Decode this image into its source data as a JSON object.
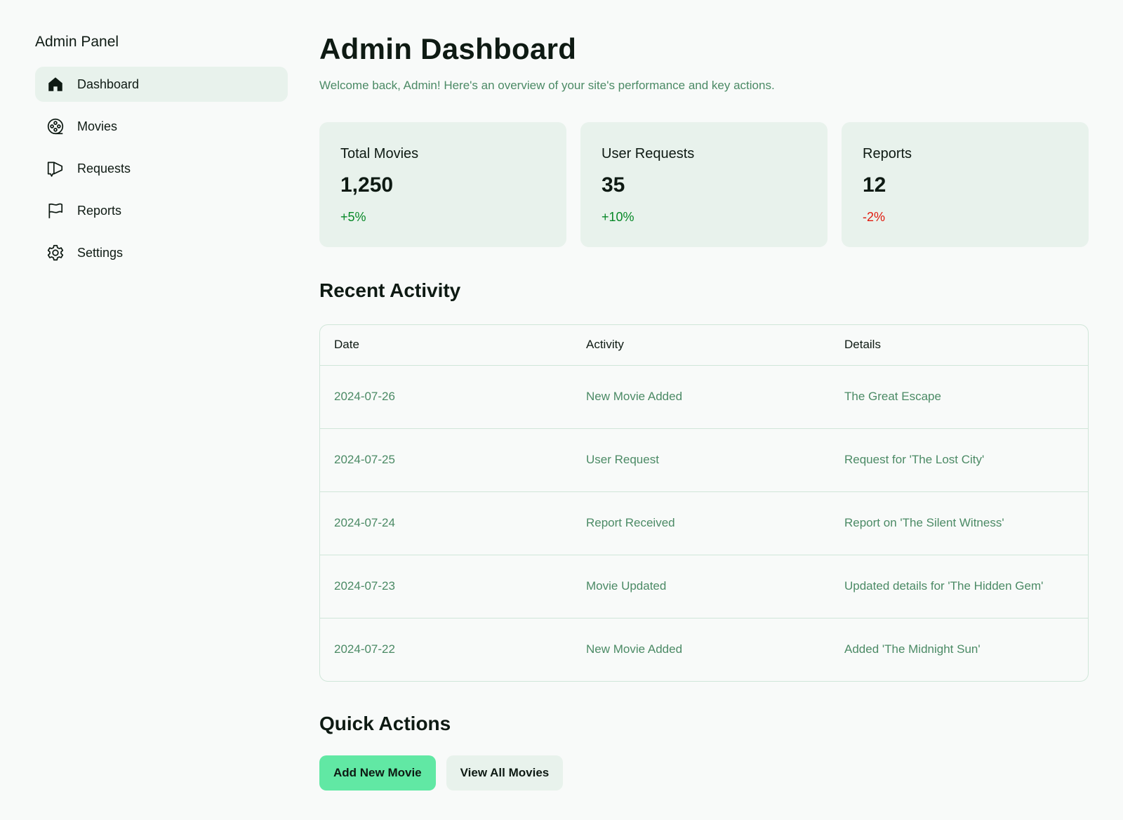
{
  "sidebar": {
    "title": "Admin Panel",
    "items": [
      {
        "label": "Dashboard",
        "icon": "home-icon",
        "active": true
      },
      {
        "label": "Movies",
        "icon": "film-reel-icon"
      },
      {
        "label": "Requests",
        "icon": "megaphone-icon"
      },
      {
        "label": "Reports",
        "icon": "flag-icon"
      },
      {
        "label": "Settings",
        "icon": "gear-icon"
      }
    ]
  },
  "header": {
    "title": "Admin Dashboard",
    "subtitle": "Welcome back, Admin! Here's an overview of your site's performance and key actions."
  },
  "stats": [
    {
      "label": "Total Movies",
      "value": "1,250",
      "change": "+5%",
      "trend": "up"
    },
    {
      "label": "User Requests",
      "value": "35",
      "change": "+10%",
      "trend": "up"
    },
    {
      "label": "Reports",
      "value": "12",
      "change": "-2%",
      "trend": "down"
    }
  ],
  "recent_activity": {
    "title": "Recent Activity",
    "columns": [
      "Date",
      "Activity",
      "Details"
    ],
    "rows": [
      [
        "2024-07-26",
        "New Movie Added",
        "The Great Escape"
      ],
      [
        "2024-07-25",
        "User Request",
        "Request for 'The Lost City'"
      ],
      [
        "2024-07-24",
        "Report Received",
        "Report on 'The Silent Witness'"
      ],
      [
        "2024-07-23",
        "Movie Updated",
        "Updated details for 'The Hidden Gem'"
      ],
      [
        "2024-07-22",
        "New Movie Added",
        "Added 'The Midnight Sun'"
      ]
    ]
  },
  "quick_actions": {
    "title": "Quick Actions",
    "add_label": "Add New Movie",
    "view_label": "View All Movies"
  },
  "colors": {
    "accent": "#61e8a4",
    "muted_text": "#4b8a65",
    "card_bg": "#e8f2ec",
    "positive": "#078827",
    "negative": "#e11b0e"
  }
}
